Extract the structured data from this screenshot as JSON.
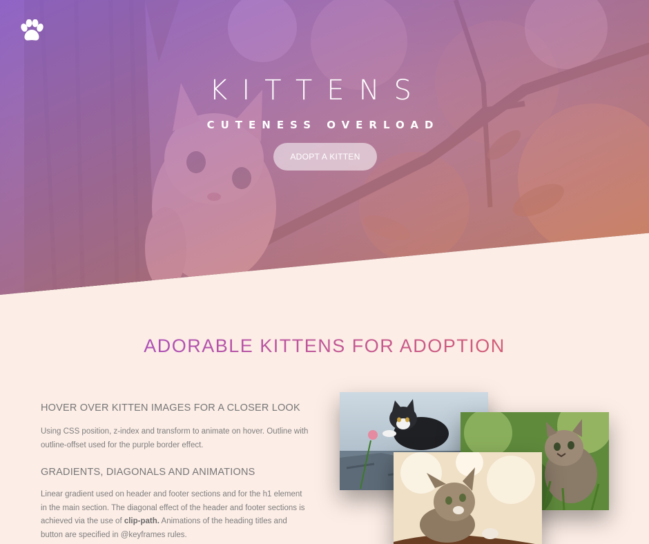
{
  "header": {
    "logo_icon": "paw-icon",
    "title": "KITTENS",
    "subtitle": "CUTENESS OVERLOAD",
    "button_label": "ADOPT A KITTEN",
    "gradient": [
      "#a06ee6",
      "#e68c5a"
    ]
  },
  "main": {
    "heading": "ADORABLE KITTENS FOR ADOPTION",
    "sections": [
      {
        "title": "HOVER OVER KITTEN IMAGES FOR A CLOSER LOOK",
        "text": "Using CSS position, z-index and transform to animate on hover. Outline with outline-offset used for the purple border effect."
      },
      {
        "title": "GRADIENTS, DIAGONALS AND ANIMATIONS",
        "text_before": "Linear gradient used on header and footer sections and for the h1 element in the main section. The diagonal effect of the header and footer sections is achieved via the use of ",
        "text_bold": "clip-path.",
        "text_after": " Animations of the heading titles and button are specified in @keyframes rules."
      }
    ]
  },
  "gallery": {
    "images": [
      "kitten-with-flower-photo",
      "kitten-in-grass-photo",
      "kitten-looking-up-photo"
    ]
  },
  "colors": {
    "background": "#fcede6",
    "heading_gradient": [
      "#9d4bd1",
      "#e2625d"
    ]
  }
}
